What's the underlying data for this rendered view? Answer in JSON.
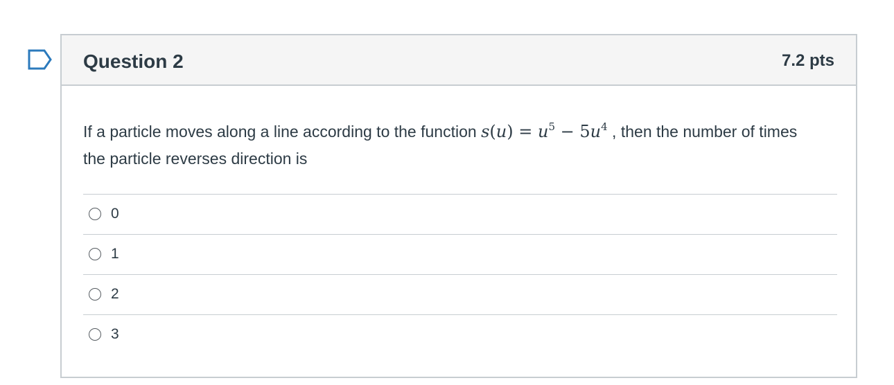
{
  "question": {
    "title": "Question 2",
    "points": "7.2 pts",
    "text_before": "If a particle moves along a line according to the function ",
    "math": {
      "fn": "s",
      "var": "u",
      "term1_base": "u",
      "term1_exp": "5",
      "operator": "−",
      "term2_coef": "5",
      "term2_base": "u",
      "term2_exp": "4"
    },
    "text_after": " , then the number of times the particle reverses direction is"
  },
  "answers": [
    {
      "label": "0"
    },
    {
      "label": "1"
    },
    {
      "label": "2"
    },
    {
      "label": "3"
    }
  ],
  "colors": {
    "flag": "#2b7abc",
    "border": "#c7cdd1",
    "header_bg": "#f5f5f5",
    "text": "#2d3b45"
  },
  "icons": {
    "flag": "flag-icon",
    "radio": "radio-icon"
  }
}
